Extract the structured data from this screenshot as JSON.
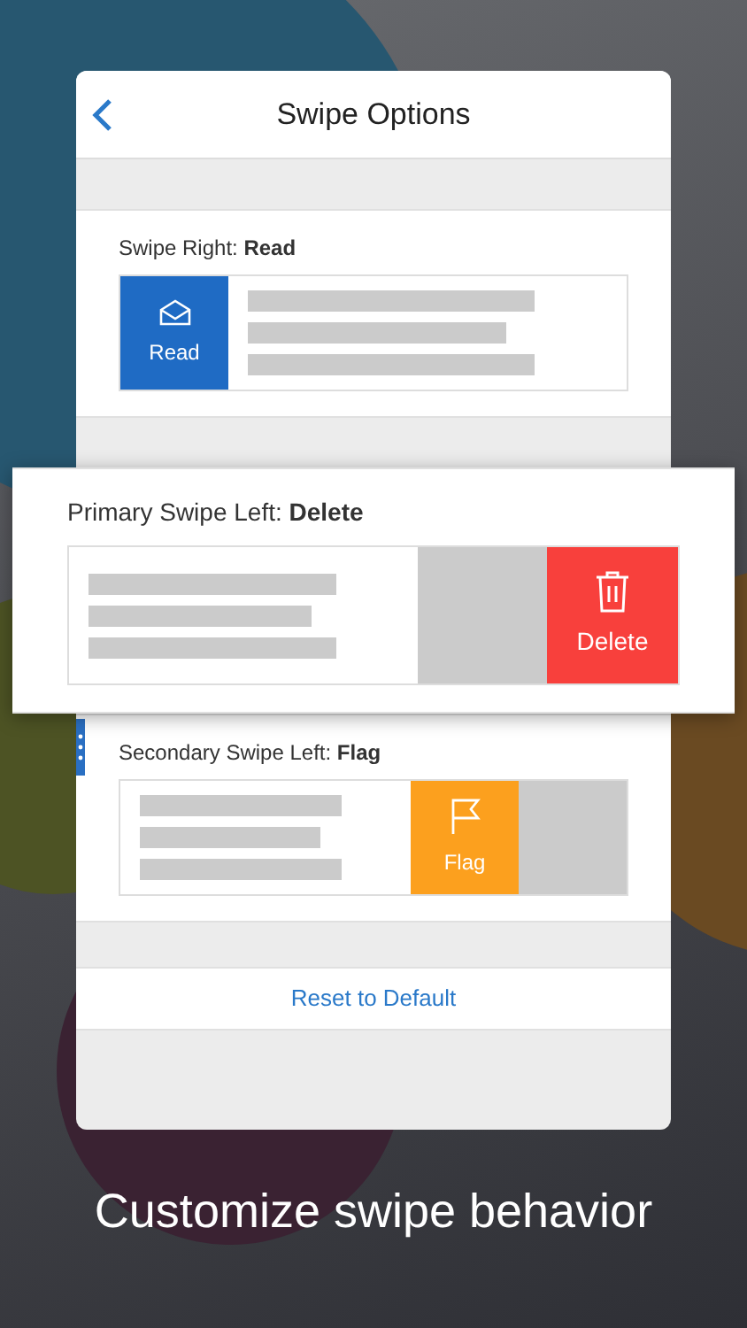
{
  "nav": {
    "title": "Swipe Options"
  },
  "options": [
    {
      "kind": "right",
      "label": "Swipe Right: **Read**",
      "action": {
        "kind": "read",
        "label": "Read",
        "color": "#1f6bc4"
      },
      "raised": false
    },
    {
      "kind": "primary_left",
      "label": "Primary Swipe Left: **Delete**",
      "action": {
        "kind": "delete",
        "label": "Delete",
        "color": "#f8403c"
      },
      "raised": true
    },
    {
      "kind": "secondary_left",
      "label": "Secondary Swipe Left: **Flag**",
      "action": {
        "kind": "flag",
        "label": "Flag",
        "color": "#fca01e"
      },
      "raised": false
    }
  ],
  "reset_button": "Reset to Default",
  "caption": "Customize swipe behavior"
}
